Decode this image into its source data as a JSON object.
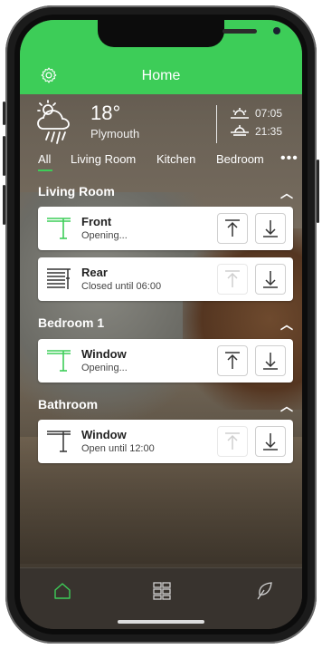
{
  "header": {
    "title": "Home",
    "accent": "#3dcd58"
  },
  "weather": {
    "temperature": "18°",
    "city": "Plymouth",
    "sunrise": "07:05",
    "sunset": "21:35",
    "icon": "cloud-rain-sun-icon"
  },
  "tabs": [
    {
      "label": "All",
      "active": true
    },
    {
      "label": "Living Room"
    },
    {
      "label": "Kitchen"
    },
    {
      "label": "Bedroom"
    }
  ],
  "more_label": "•••",
  "sections": [
    {
      "title": "Living Room",
      "devices": [
        {
          "name": "Front",
          "status": "Opening...",
          "icon": "shutter-open-icon",
          "up_enabled": true
        },
        {
          "name": "Rear",
          "status": "Closed until 06:00",
          "icon": "shutter-closed-icon",
          "up_enabled": false
        }
      ]
    },
    {
      "title": "Bedroom 1",
      "devices": [
        {
          "name": "Window",
          "status": "Opening...",
          "icon": "shutter-open-icon",
          "up_enabled": true
        }
      ]
    },
    {
      "title": "Bathroom",
      "devices": [
        {
          "name": "Window",
          "status": "Open until 12:00",
          "icon": "shutter-open-icon",
          "up_enabled": false
        }
      ]
    }
  ],
  "nav": [
    {
      "icon": "home-icon",
      "active": true
    },
    {
      "icon": "grid-icon"
    },
    {
      "icon": "leaf-icon"
    }
  ]
}
